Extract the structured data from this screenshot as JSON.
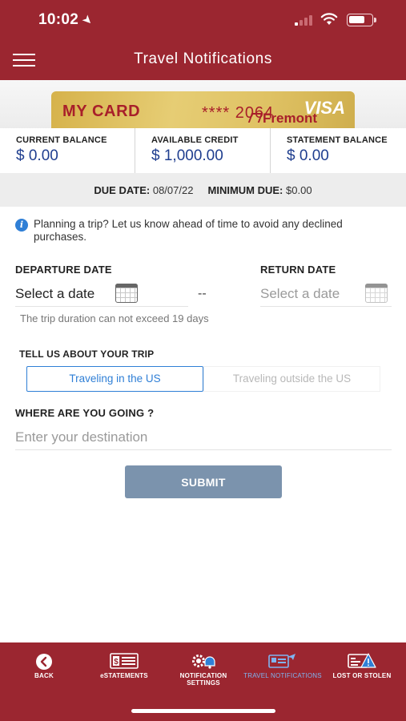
{
  "status_bar": {
    "time": "10:02"
  },
  "header": {
    "title": "Travel Notifications"
  },
  "card": {
    "name": "MY CARD",
    "number_masked": "**** 2064",
    "network": "VISA",
    "brand": "Fremont"
  },
  "balances": [
    {
      "label": "CURRENT BALANCE",
      "value": "$ 0.00"
    },
    {
      "label": "AVAILABLE CREDIT",
      "value": "$ 1,000.00"
    },
    {
      "label": "STATEMENT BALANCE",
      "value": "$ 0.00"
    }
  ],
  "due": {
    "due_date_label": "DUE DATE:",
    "due_date": "08/07/22",
    "minimum_due_label": "MINIMUM DUE:",
    "minimum_due": "$0.00"
  },
  "info": {
    "text": "Planning a trip? Let us know ahead of time to avoid any declined purchases."
  },
  "dates": {
    "departure_label": "DEPARTURE DATE",
    "departure_value": "Select a date",
    "separator": "--",
    "return_label": "RETURN DATE",
    "return_value": "Select a date",
    "hint": "The trip duration can not exceed 19 days"
  },
  "trip": {
    "label": "TELL US ABOUT YOUR TRIP",
    "options": [
      "Traveling in the US",
      "Traveling outside the US"
    ],
    "selected": "Traveling in the US"
  },
  "destination": {
    "label": "WHERE ARE YOU GOING ?",
    "placeholder": "Enter your destination"
  },
  "submit_label": "SUBMIT",
  "nav": [
    {
      "label": "BACK",
      "icon": "back-arrow-icon"
    },
    {
      "label": "eSTATEMENTS",
      "icon": "statement-icon"
    },
    {
      "label": "NOTIFICATION SETTINGS",
      "icon": "notification-settings-icon"
    },
    {
      "label": "TRAVEL NOTIFICATIONS",
      "icon": "travel-icon",
      "active": true
    },
    {
      "label": "LOST OR STOLEN",
      "icon": "lost-card-icon"
    }
  ],
  "colors": {
    "brand": "#9b2630",
    "accent": "#2f7fd6",
    "amount": "#1f3e8f",
    "submit": "#7b93ad",
    "active_nav": "#7fb4f0"
  }
}
